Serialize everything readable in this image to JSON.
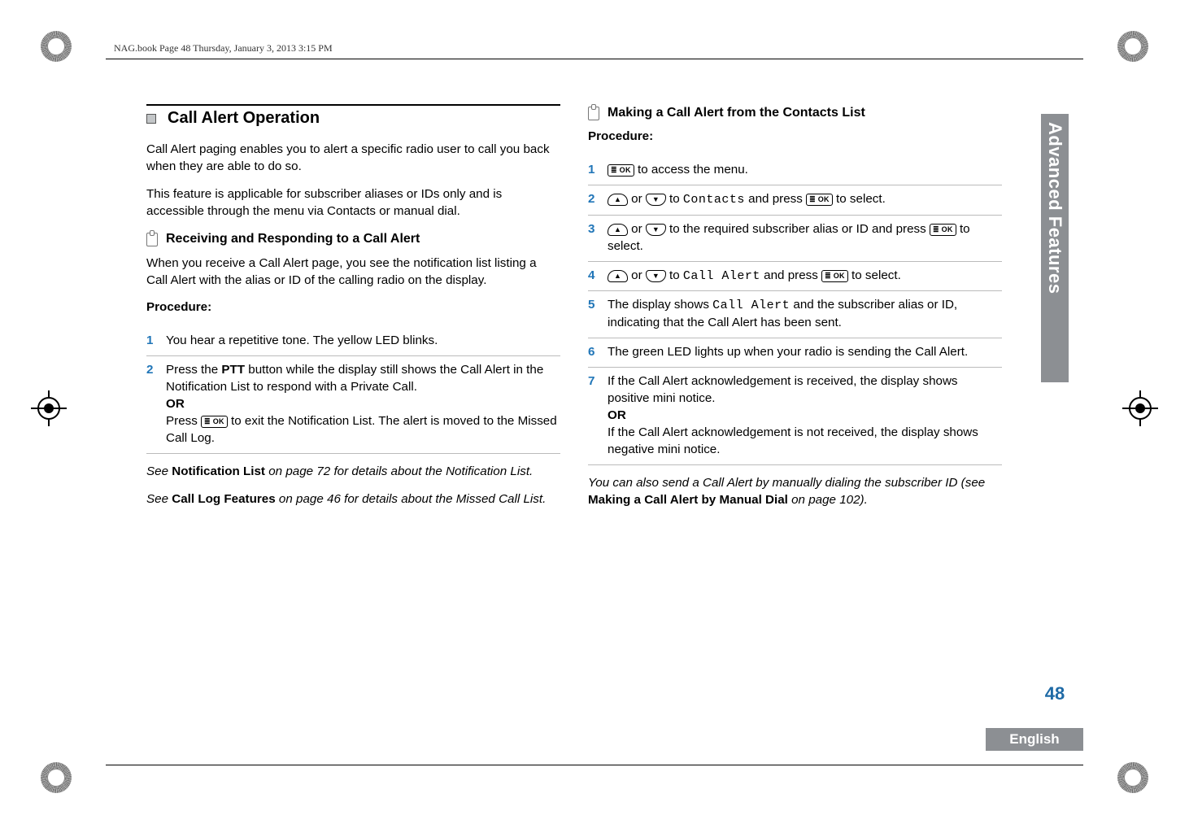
{
  "header": {
    "running_head": "NAG.book  Page 48  Thursday, January 3, 2013  3:15 PM"
  },
  "side_tab": "Advanced Features",
  "page_number": "48",
  "language": "English",
  "left": {
    "section_title": "Call Alert Operation",
    "intro1": "Call Alert paging enables you to alert a specific radio user to call you back when they are able to do so.",
    "intro2": "This feature is applicable for subscriber aliases or IDs only and is accessible through the menu via Contacts or manual dial.",
    "sub1_title": "Receiving and Responding to a Call Alert",
    "sub1_intro": "When you receive a Call Alert page, you see the notification list listing a Call Alert with the alias or ID of the calling radio on the display.",
    "procedure_label": "Procedure:",
    "step1": "You hear a repetitive tone. The yellow LED blinks.",
    "step2_a": "Press the ",
    "step2_ptt": "PTT",
    "step2_b": " button while the display still shows the Call Alert in the Notification List to respond with a Private Call.",
    "step2_or": "OR",
    "step2_c_pre": "Press ",
    "step2_c_post": " to exit the Notification List. The alert is moved to the Missed Call Log.",
    "note1_a": "See ",
    "note1_bold": "Notification List",
    "note1_b": " on page 72 for details about the Notification List.",
    "note2_a": "See ",
    "note2_bold": "Call Log Features",
    "note2_b": " on page 46 for details about the Missed Call List."
  },
  "right": {
    "sub_title": "Making a Call Alert from the Contacts List",
    "procedure_label": "Procedure:",
    "s1_post": " to access the menu.",
    "s2_mid": " to ",
    "s2_mono": "Contacts",
    "s2_post": " and press ",
    "s2_end": " to select.",
    "s3_mid": " to the required subscriber alias or ID and press ",
    "s3_end": " to select.",
    "s4_mid": " to ",
    "s4_mono": "Call Alert",
    "s4_post": " and press ",
    "s4_end": " to select.",
    "s5_a": "The display shows ",
    "s5_mono": "Call Alert",
    "s5_b": " and the subscriber alias or ID, indicating that the Call Alert has been sent.",
    "s6": "The green LED lights up when your radio is sending the Call Alert.",
    "s7_a": "If the Call Alert acknowledgement is received, the display shows positive mini notice.",
    "s7_or": "OR",
    "s7_b": "If the Call Alert acknowledgement is not received, the display shows negative mini notice.",
    "note_a": "You can also send a Call Alert by manually dialing the subscriber ID (see ",
    "note_bold": "Making a Call Alert by Manual Dial",
    "note_b": " on page 102)."
  },
  "icons": {
    "ok_label": "≣ OK",
    "up": "▲",
    "down": "▼",
    "or_word": " or "
  }
}
